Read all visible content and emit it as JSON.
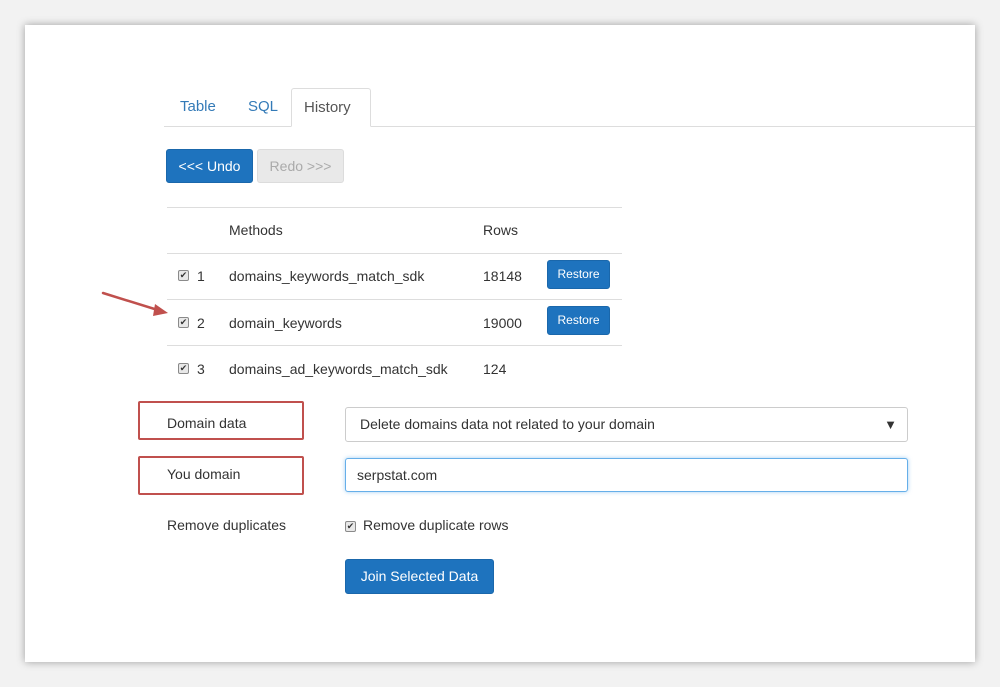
{
  "tabs": [
    {
      "label": "Table",
      "active": false
    },
    {
      "label": "SQL",
      "active": false
    },
    {
      "label": "History",
      "active": true
    }
  ],
  "history_controls": {
    "undo_label": "<<< Undo",
    "redo_label": "Redo >>>"
  },
  "history_table": {
    "columns": [
      "Methods",
      "Rows"
    ],
    "rows": [
      {
        "index": "1",
        "checked": true,
        "method": "domains_keywords_match_sdk",
        "rows": "18148",
        "action": "Restore"
      },
      {
        "index": "2",
        "checked": true,
        "method": "domain_keywords",
        "rows": "19000",
        "action": "Restore"
      },
      {
        "index": "3",
        "checked": true,
        "method": "domains_ad_keywords_match_sdk",
        "rows": "124",
        "action": ""
      }
    ]
  },
  "form": {
    "domain_data_label": "Domain data",
    "domain_data_value": "Delete domains data not related to your domain",
    "you_domain_label": "You domain",
    "you_domain_value": "serpstat.com",
    "remove_duplicates_label": "Remove duplicates",
    "remove_duplicates_checkbox_label": "Remove duplicate rows",
    "remove_duplicates_checked": true,
    "submit_label": "Join Selected Data"
  },
  "colors": {
    "primary": "#1e73be",
    "annotation": "#c0504d",
    "link": "#337ab7"
  }
}
